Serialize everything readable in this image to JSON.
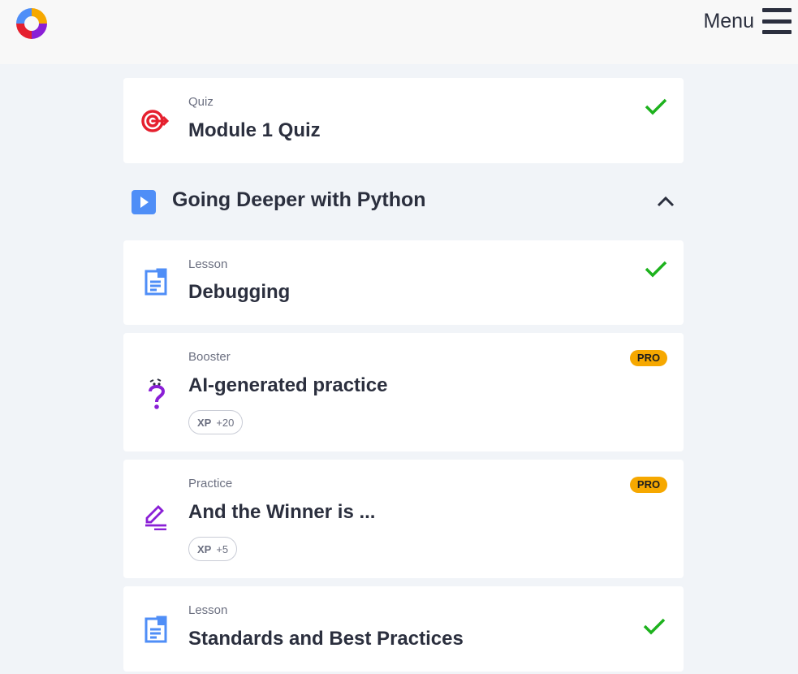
{
  "header": {
    "logo_name": "app-logo",
    "menu_label": "Menu"
  },
  "colors": {
    "accent_blue": "#4f8ef7",
    "quiz_red": "#e5202e",
    "booster_purple": "#8a1fd6",
    "check_green": "#1db21d",
    "pro_yellow": "#f6a800"
  },
  "cards": [
    {
      "kind": "Quiz",
      "title": "Module 1 Quiz",
      "icon": "target-icon",
      "completed": true
    },
    {
      "kind": "Lesson",
      "title": "Debugging",
      "icon": "document-icon",
      "completed": true
    },
    {
      "kind": "Booster",
      "title": "AI-generated practice",
      "icon": "question-icon",
      "badge": "PRO",
      "xp_label": "XP",
      "xp_value": "+20"
    },
    {
      "kind": "Practice",
      "title": "And the Winner is ...",
      "icon": "edit-icon",
      "badge": "PRO",
      "xp_label": "XP",
      "xp_value": "+5"
    },
    {
      "kind": "Lesson",
      "title": "Standards and Best Practices",
      "icon": "document-icon",
      "completed": true
    }
  ],
  "section": {
    "title": "Going Deeper with Python",
    "icon": "play-icon",
    "chevron": "chevron-up-icon"
  }
}
